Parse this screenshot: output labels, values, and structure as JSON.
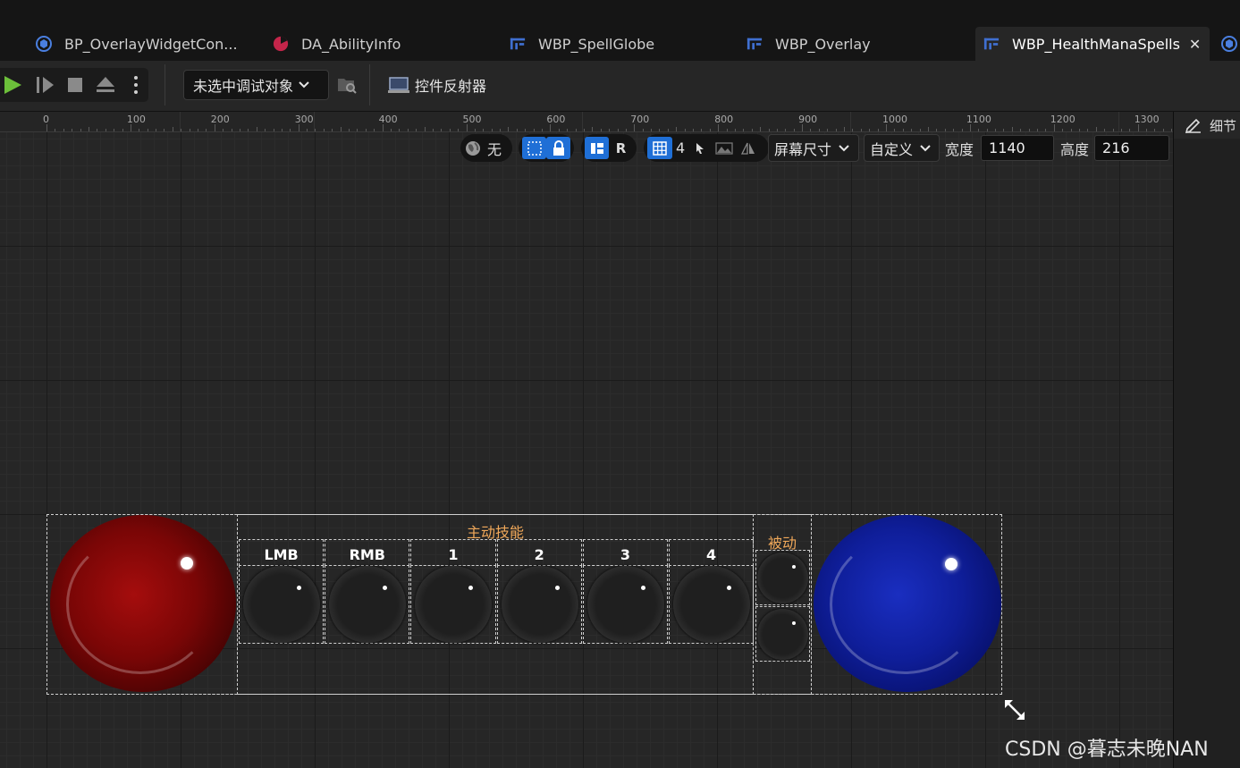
{
  "tabs": [
    {
      "label": "BP_OverlayWidgetCon...",
      "icon": "blueprint-icon",
      "active": false
    },
    {
      "label": "DA_AbilityInfo",
      "icon": "data-asset-icon",
      "active": false
    },
    {
      "label": "WBP_SpellGlobe",
      "icon": "widget-blueprint-icon",
      "active": false
    },
    {
      "label": "WBP_Overlay",
      "icon": "widget-blueprint-icon",
      "active": false
    },
    {
      "label": "WBP_HealthManaSpells",
      "icon": "widget-blueprint-icon",
      "active": true
    }
  ],
  "toolbar": {
    "debug_target": "未选中调试对象",
    "widget_reflector": "控件反射器"
  },
  "ruler": {
    "labels": [
      "0",
      "100",
      "200",
      "300",
      "400",
      "500",
      "600",
      "700",
      "800",
      "900",
      "1000",
      "1100",
      "1200",
      "1300"
    ]
  },
  "right_panel": {
    "title": "细节"
  },
  "viewport": {
    "localization": "无",
    "r_label": "R",
    "grid_size": "4",
    "screen_size": "屏幕尺寸",
    "size_mode": "自定义",
    "width_label": "宽度",
    "width_value": "1140",
    "height_label": "高度",
    "height_value": "216"
  },
  "hud": {
    "active_title": "主动技能",
    "passive_title": "被动",
    "slots": [
      "LMB",
      "RMB",
      "1",
      "2",
      "3",
      "4"
    ]
  },
  "colors": {
    "accent": "#1f6fd6",
    "gold": "#e0a030",
    "health": "#8b0a0a",
    "mana": "#0d1f9a",
    "play": "#6cbf3a"
  },
  "watermark": "CSDN @暮志未晚NAN"
}
